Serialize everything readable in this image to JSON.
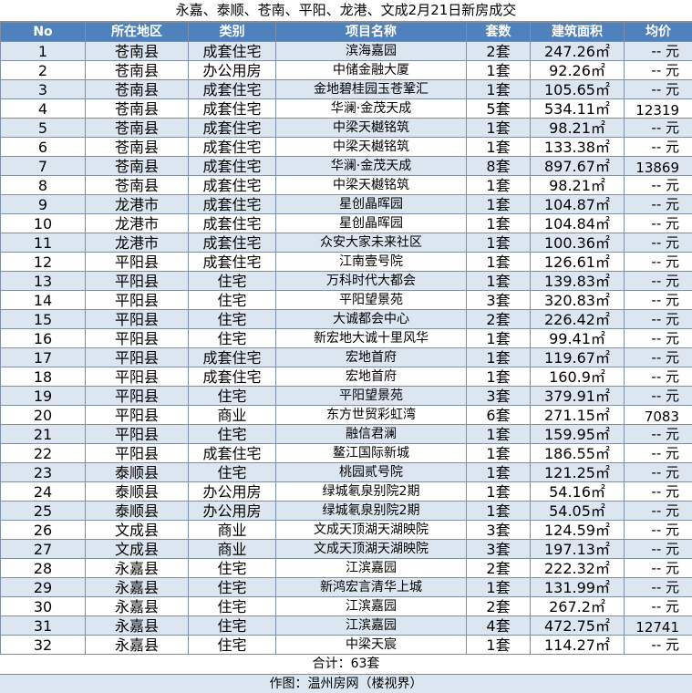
{
  "title": "永嘉、泰顺、苍南、平阳、龙港、文成2月21日新房成交",
  "headers": [
    "No",
    "所在地区",
    "类别",
    "项目名称",
    "套数",
    "建筑面积",
    "均价"
  ],
  "rows": [
    {
      "no": "1",
      "area": "苍南县",
      "type": "成套住宅",
      "project": "滨海嘉园",
      "units": "2套",
      "size": "247.26㎡",
      "price": "-- 元"
    },
    {
      "no": "2",
      "area": "苍南县",
      "type": "办公用房",
      "project": "中储金融大厦",
      "units": "1套",
      "size": "92.26㎡",
      "price": "-- 元"
    },
    {
      "no": "3",
      "area": "苍南县",
      "type": "成套住宅",
      "project": "金地碧桂园玉苍鞏汇",
      "units": "1套",
      "size": "105.65㎡",
      "price": "-- 元"
    },
    {
      "no": "4",
      "area": "苍南县",
      "type": "成套住宅",
      "project": "华澜·金茂天成",
      "units": "5套",
      "size": "534.11㎡",
      "price": "12319"
    },
    {
      "no": "5",
      "area": "苍南县",
      "type": "成套住宅",
      "project": "中梁天樾铭筑",
      "units": "1套",
      "size": "98.21㎡",
      "price": "-- 元"
    },
    {
      "no": "6",
      "area": "苍南县",
      "type": "成套住宅",
      "project": "中梁天樾铭筑",
      "units": "1套",
      "size": "133.38㎡",
      "price": "-- 元"
    },
    {
      "no": "7",
      "area": "苍南县",
      "type": "成套住宅",
      "project": "华澜·金茂天成",
      "units": "8套",
      "size": "897.67㎡",
      "price": "13869"
    },
    {
      "no": "8",
      "area": "苍南县",
      "type": "成套住宅",
      "project": "中梁天樾铭筑",
      "units": "1套",
      "size": "98.21㎡",
      "price": "-- 元"
    },
    {
      "no": "9",
      "area": "龙港市",
      "type": "成套住宅",
      "project": "星创晶晖园",
      "units": "1套",
      "size": "104.87㎡",
      "price": "-- 元"
    },
    {
      "no": "10",
      "area": "龙港市",
      "type": "成套住宅",
      "project": "星创晶晖园",
      "units": "1套",
      "size": "104.84㎡",
      "price": "-- 元"
    },
    {
      "no": "11",
      "area": "龙港市",
      "type": "成套住宅",
      "project": "众安大家未来社区",
      "units": "1套",
      "size": "100.36㎡",
      "price": "-- 元"
    },
    {
      "no": "12",
      "area": "平阳县",
      "type": "成套住宅",
      "project": "江南壹号院",
      "units": "1套",
      "size": "126.61㎡",
      "price": "-- 元"
    },
    {
      "no": "13",
      "area": "平阳县",
      "type": "住宅",
      "project": "万科时代大都会",
      "units": "1套",
      "size": "139.83㎡",
      "price": "-- 元"
    },
    {
      "no": "14",
      "area": "平阳县",
      "type": "住宅",
      "project": "平阳望景苑",
      "units": "3套",
      "size": "320.83㎡",
      "price": "-- 元"
    },
    {
      "no": "15",
      "area": "平阳县",
      "type": "住宅",
      "project": "大诚都会中心",
      "units": "2套",
      "size": "226.42㎡",
      "price": "-- 元"
    },
    {
      "no": "16",
      "area": "平阳县",
      "type": "住宅",
      "project": "新宏地大诚十里风华",
      "units": "1套",
      "size": "99.41㎡",
      "price": "-- 元"
    },
    {
      "no": "17",
      "area": "平阳县",
      "type": "成套住宅",
      "project": "宏地首府",
      "units": "1套",
      "size": "119.67㎡",
      "price": "-- 元"
    },
    {
      "no": "18",
      "area": "平阳县",
      "type": "成套住宅",
      "project": "宏地首府",
      "units": "1套",
      "size": "160.9㎡",
      "price": "-- 元"
    },
    {
      "no": "19",
      "area": "平阳县",
      "type": "住宅",
      "project": "平阳望景苑",
      "units": "3套",
      "size": "379.91㎡",
      "price": "-- 元"
    },
    {
      "no": "20",
      "area": "平阳县",
      "type": "商业",
      "project": "东方世贸彩虹湾",
      "units": "6套",
      "size": "271.15㎡",
      "price": "7083"
    },
    {
      "no": "21",
      "area": "平阳县",
      "type": "住宅",
      "project": "融信君澜",
      "units": "1套",
      "size": "159.95㎡",
      "price": "-- 元"
    },
    {
      "no": "22",
      "area": "平阳县",
      "type": "成套住宅",
      "project": "鳌江国际新城",
      "units": "1套",
      "size": "186.55㎡",
      "price": "-- 元"
    },
    {
      "no": "23",
      "area": "泰顺县",
      "type": "住宅",
      "project": "桃园贰号院",
      "units": "1套",
      "size": "121.25㎡",
      "price": "-- 元"
    },
    {
      "no": "24",
      "area": "泰顺县",
      "type": "办公用房",
      "project": "绿城氡泉别院2期",
      "units": "1套",
      "size": "54.16㎡",
      "price": "-- 元"
    },
    {
      "no": "25",
      "area": "泰顺县",
      "type": "办公用房",
      "project": "绿城氡泉别院2期",
      "units": "1套",
      "size": "54.05㎡",
      "price": "-- 元"
    },
    {
      "no": "26",
      "area": "文成县",
      "type": "商业",
      "project": "文成天顶湖天湖映院",
      "units": "3套",
      "size": "124.59㎡",
      "price": "-- 元"
    },
    {
      "no": "27",
      "area": "文成县",
      "type": "商业",
      "project": "文成天顶湖天湖映院",
      "units": "3套",
      "size": "197.13㎡",
      "price": "-- 元"
    },
    {
      "no": "28",
      "area": "永嘉县",
      "type": "住宅",
      "project": "江滨嘉园",
      "units": "2套",
      "size": "222.32㎡",
      "price": "-- 元"
    },
    {
      "no": "29",
      "area": "永嘉县",
      "type": "住宅",
      "project": "新鸿宏言清华上城",
      "units": "1套",
      "size": "131.99㎡",
      "price": "-- 元"
    },
    {
      "no": "30",
      "area": "永嘉县",
      "type": "住宅",
      "project": "江滨嘉园",
      "units": "2套",
      "size": "267.2㎡",
      "price": "-- 元"
    },
    {
      "no": "31",
      "area": "永嘉县",
      "type": "住宅",
      "project": "江滨嘉园",
      "units": "4套",
      "size": "472.75㎡",
      "price": "12741"
    },
    {
      "no": "32",
      "area": "永嘉县",
      "type": "住宅",
      "project": "中梁天宸",
      "units": "1套",
      "size": "114.27㎡",
      "price": "-- 元"
    }
  ],
  "total": "合计：63套",
  "maker": "作图：温州房网（楼视界）",
  "colors": {
    "header_bg": "#4f81bd",
    "stripe_bg": "#dce6f1",
    "border": "#7f8fa6"
  }
}
